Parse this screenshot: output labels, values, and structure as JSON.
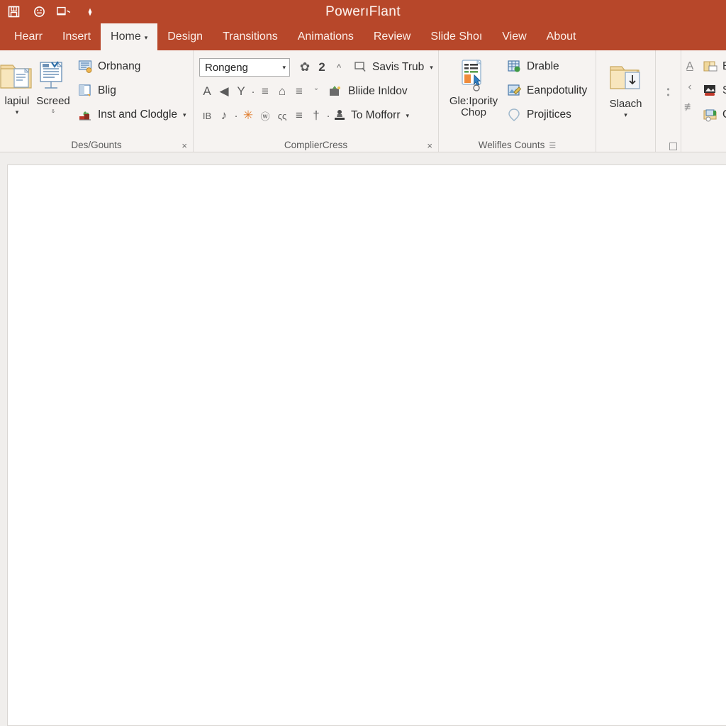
{
  "window": {
    "title": "PowerıFlant",
    "brand_color": "#b7472a",
    "ribbon_bg": "#f6f3f1",
    "workspace_bg": "#f0eeec"
  },
  "quick_access": [
    {
      "name": "save-icon",
      "label": "Save"
    },
    {
      "name": "undo-circle-icon",
      "label": "Undo"
    },
    {
      "name": "window-dropdown-icon",
      "label": "Window"
    },
    {
      "name": "diamond-icon",
      "label": "Customize"
    }
  ],
  "tabs": [
    {
      "label": "Hearr",
      "active": false,
      "caret": ""
    },
    {
      "label": "Insert",
      "active": false,
      "caret": ""
    },
    {
      "label": "Home",
      "active": true,
      "caret": "▾"
    },
    {
      "label": "Design",
      "active": false,
      "caret": ""
    },
    {
      "label": "Transitions",
      "active": false,
      "caret": ""
    },
    {
      "label": "Animations",
      "active": false,
      "caret": ""
    },
    {
      "label": "Review",
      "active": false,
      "caret": ""
    },
    {
      "label": "Slide Shoı",
      "active": false,
      "caret": ""
    },
    {
      "label": "View",
      "active": false,
      "caret": ""
    },
    {
      "label": "About",
      "active": false,
      "caret": ""
    }
  ],
  "ribbon": {
    "group1": {
      "label": "Des/Gounts",
      "close": "×",
      "big_buttons": [
        {
          "label": "lapiul",
          "arrow": "▾",
          "icon": "folder-document-icon"
        },
        {
          "label": "Screed",
          "arrow": "ᵟ",
          "icon": "slide-list-icon"
        }
      ],
      "small_buttons": [
        {
          "label": "Orbnang",
          "icon": "screen-presentation-icon",
          "arrow": ""
        },
        {
          "label": "Blig",
          "icon": "layout-page-icon",
          "arrow": ""
        },
        {
          "label": "Inst and Clodgle",
          "icon": "plant-insert-icon",
          "arrow": "▾"
        }
      ]
    },
    "group2": {
      "label": "ComplierCress",
      "close": "×",
      "font_combo": {
        "value": "Rongeng",
        "caret": "▾"
      },
      "row1_icons": [
        {
          "name": "gear-glyph-icon",
          "glyph": "✿"
        },
        {
          "name": "bold-two-icon",
          "glyph": "2"
        },
        {
          "name": "chevron-up-icon",
          "glyph": "^"
        }
      ],
      "row2_icons": [
        {
          "name": "font-a-icon",
          "glyph": "A"
        },
        {
          "name": "triangle-left-icon",
          "glyph": "◀"
        },
        {
          "name": "clear-format-icon",
          "glyph": "Υ"
        },
        {
          "name": "dot-separator-icon",
          "glyph": "·"
        },
        {
          "name": "align-lines-icon",
          "glyph": "≡"
        },
        {
          "name": "shape-basket-icon",
          "glyph": "⌂"
        },
        {
          "name": "align-center-icon",
          "glyph": "≡"
        },
        {
          "name": "chevron-down-icon",
          "glyph": "ˇ"
        }
      ],
      "row3_icons": [
        {
          "name": "italic-bold-ib-icon",
          "glyph": "IB"
        },
        {
          "name": "music-note-icon",
          "glyph": "♪"
        },
        {
          "name": "dot-separator-icon",
          "glyph": "·"
        },
        {
          "name": "color-star-icon",
          "glyph": "✳"
        },
        {
          "name": "circle-glyph-icon",
          "glyph": "ⓦ"
        },
        {
          "name": "small-glyph-icon",
          "glyph": "ςς"
        },
        {
          "name": "lines-icon",
          "glyph": "≡"
        },
        {
          "name": "dagger-icon",
          "glyph": "†"
        },
        {
          "name": "dot-separator-icon",
          "glyph": "·"
        }
      ],
      "labeled_buttons": [
        {
          "label": "Savis Trub",
          "icon": "search-box-icon",
          "arrow": "▾"
        },
        {
          "label": "Bliide Inldov",
          "icon": "slide-insert-icon",
          "arrow": ""
        },
        {
          "label": "To Mofforr",
          "icon": "stamp-icon",
          "arrow": "▾"
        }
      ]
    },
    "group3": {
      "label": "Welifles Counts",
      "launcher": "☰",
      "big_button": {
        "label_line1": "Gle:Iporiŧy",
        "label_line2": "Chop",
        "icon": "document-cursor-icon"
      },
      "small_buttons": [
        {
          "label": "Drable",
          "icon": "table-green-icon"
        },
        {
          "label": "Eanpdotulity",
          "icon": "image-edit-icon"
        },
        {
          "label": "Projitices",
          "icon": "location-pin-icon"
        }
      ]
    },
    "group4": {
      "big_button": {
        "label": "Slaach",
        "arrow": "▾",
        "icon": "folder-download-icon"
      }
    },
    "group5": {
      "tiny_icons": [
        {
          "name": "underline-a-icon",
          "glyph": "A̲"
        },
        {
          "name": "chevron-left-icon",
          "glyph": "‹"
        },
        {
          "name": "no-pencil-icon",
          "glyph": "≢"
        }
      ],
      "small_buttons": [
        {
          "label": "Ba",
          "icon": "book-comment-icon"
        },
        {
          "label": "Se",
          "icon": "picture-frame-icon"
        },
        {
          "label": "Cu",
          "icon": "folder-export-icon"
        }
      ]
    }
  },
  "canvas": {
    "name": "slide-canvas"
  }
}
